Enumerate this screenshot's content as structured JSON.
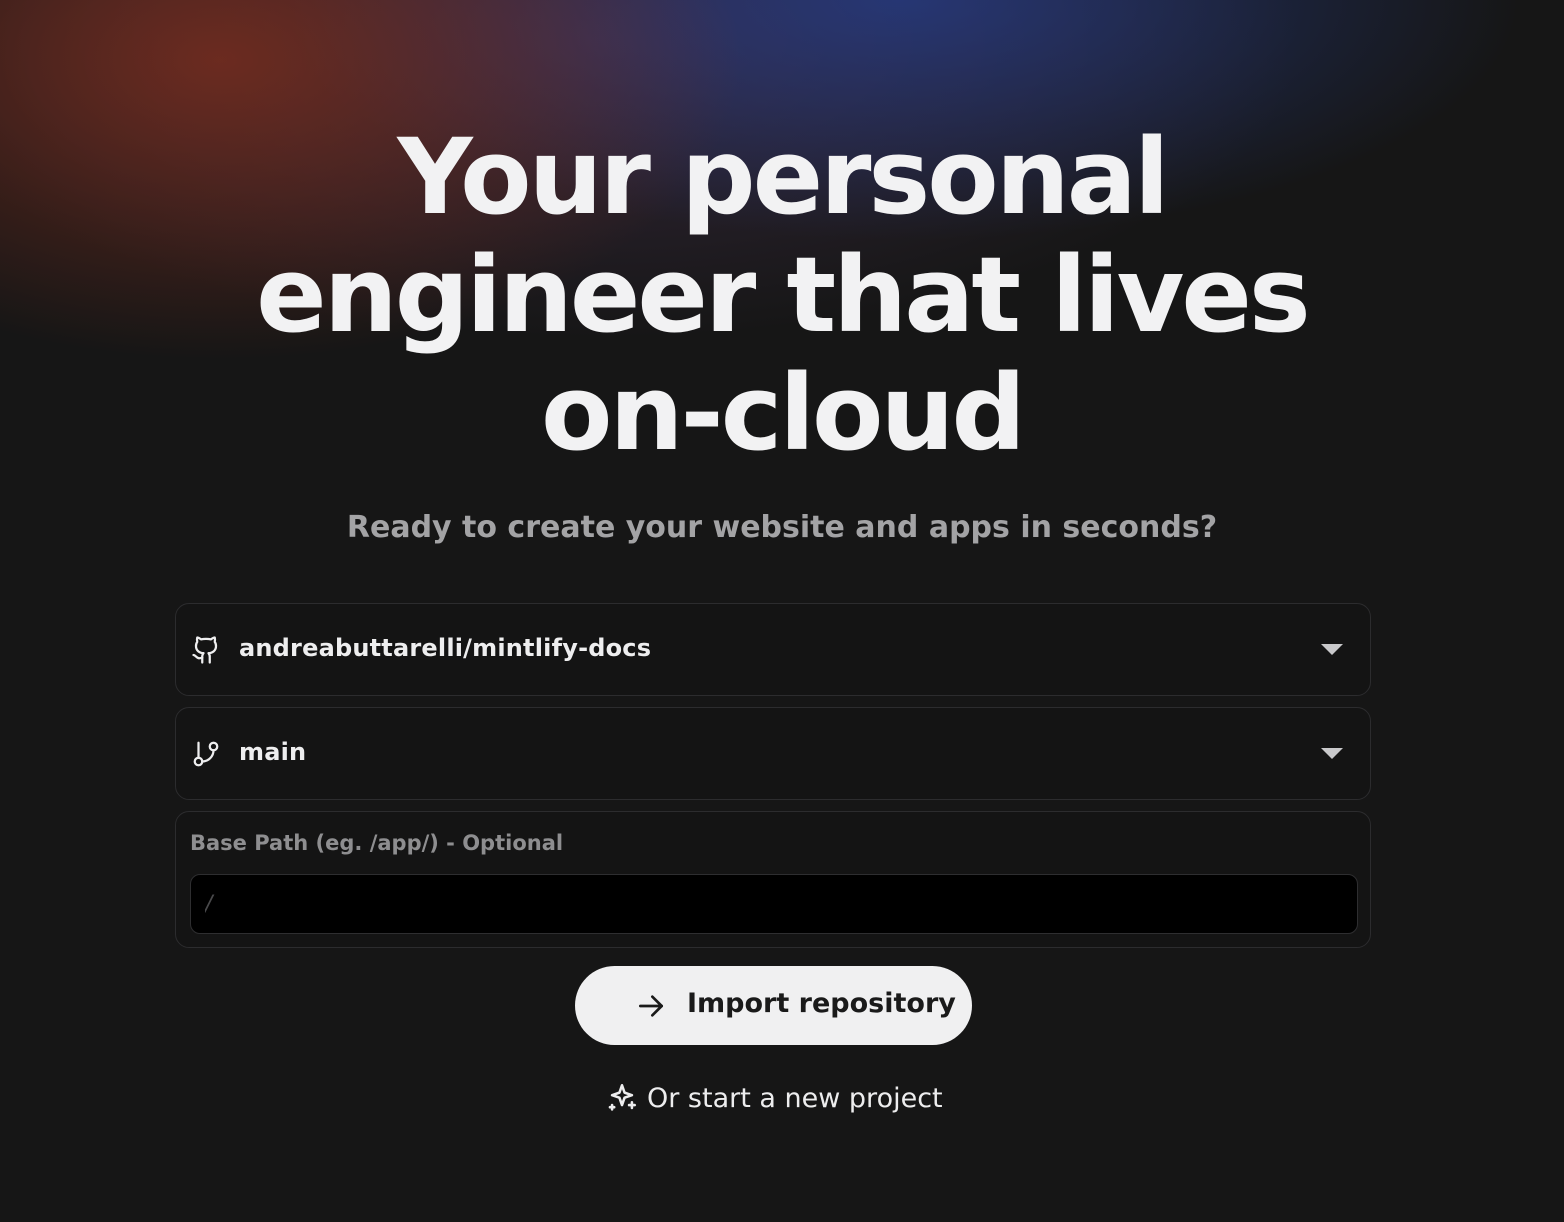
{
  "hero": {
    "headline": "Your personal engineer that lives on-cloud",
    "subtitle": "Ready to create your website and apps in seconds?"
  },
  "form": {
    "repository": {
      "icon": "github-icon",
      "value": "andreabuttarelli/mintlify-docs"
    },
    "branch": {
      "icon": "git-branch-icon",
      "value": "main"
    },
    "base_path": {
      "label": "Base Path (eg. /app/) - Optional",
      "placeholder": "/",
      "value": ""
    },
    "import_button": {
      "icon": "arrow-right-icon",
      "label": "Import repository"
    },
    "new_project": {
      "icon": "sparkle-icon",
      "label": "Or start a new project"
    }
  },
  "colors": {
    "background": "#161616",
    "button_bg": "#f0f0f1",
    "text_primary": "#f2f2f3",
    "text_muted": "#a3a3a5"
  }
}
